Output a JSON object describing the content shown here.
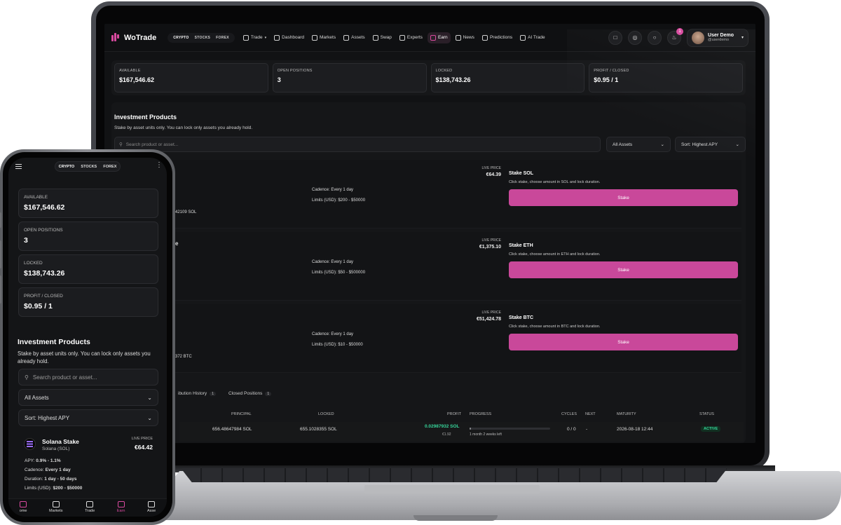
{
  "brand": {
    "name": "WoTrade",
    "accent": "#d94a9f",
    "button_color": "#c9489a"
  },
  "nav": {
    "segments": [
      "CRYPTO",
      "STOCKS",
      "FOREX"
    ],
    "items": [
      {
        "label": "Trade",
        "icon": "trade-icon"
      },
      {
        "label": "Dashboard",
        "icon": "home-icon"
      },
      {
        "label": "Markets",
        "icon": "chart-icon"
      },
      {
        "label": "Assets",
        "icon": "briefcase-icon"
      },
      {
        "label": "Swap",
        "icon": "swap-icon"
      },
      {
        "label": "Experts",
        "icon": "experts-icon"
      },
      {
        "label": "Earn",
        "icon": "wallet-icon"
      },
      {
        "label": "News",
        "icon": "news-icon"
      },
      {
        "label": "Predictions",
        "icon": "predictions-icon"
      },
      {
        "label": "AI Trade",
        "icon": "robot-icon"
      }
    ],
    "notification_count": "1",
    "user": {
      "name": "User Demo",
      "handle": "@userdemo"
    }
  },
  "stats": [
    {
      "label": "AVAILABLE",
      "value": "$167,546.62"
    },
    {
      "label": "OPEN POSITIONS",
      "value": "3"
    },
    {
      "label": "LOCKED",
      "value": "$138,743.26"
    },
    {
      "label": "PROFIT / CLOSED",
      "value": "$0.95 / 1"
    }
  ],
  "invest": {
    "title": "Investment Products",
    "subtitle": "Stake by asset units only. You can lock only assets you already hold.",
    "search_placeholder": "Search product or asset...",
    "filter": "All Assets",
    "sort": "Sort: Highest APY",
    "live_price_label": "LIVE PRICE",
    "lock_hint_prefix": "Click stake, choose amount in",
    "stake_label": "Stake"
  },
  "products": [
    {
      "stake_title": "Stake SOL",
      "live_price": "€64.39",
      "cadence": "Cadence: Every 1 day",
      "limits": "Limits (USD): $200 - $50000",
      "fragment": "42109 SOL",
      "hint": "Click stake, choose amount in SOL and lock duration."
    },
    {
      "stake_title": "Stake ETH",
      "live_price": "€1,375.10",
      "cadence": "Cadence: Every 1 day",
      "limits": "Limits (USD): $50 - $500000",
      "fragment": "e",
      "hint": "Click stake, choose amount in ETH and lock duration."
    },
    {
      "stake_title": "Stake BTC",
      "live_price": "€51,424.78",
      "cadence": "Cadence: Every 1 day",
      "limits": "Limits (USD): $10 - $50000",
      "fragment": "372 BTC",
      "hint": "Click stake, choose amount in BTC and lock duration."
    }
  ],
  "tabs": [
    {
      "label": "ibution History",
      "count": "1"
    },
    {
      "label": "Closed Positions",
      "count": "1"
    }
  ],
  "table": {
    "headers": [
      "PRINCIPAL",
      "LOCKED",
      "PROFIT",
      "PROGRESS",
      "CYCLES",
      "NEXT",
      "MATURITY",
      "STATUS"
    ],
    "row": {
      "principal": "656.48647984 SOL",
      "locked": "655.1028355 SOL",
      "profit": "0.02987932 SOL",
      "profit_fiat": "€1.92",
      "progress_text": "1 month 2 weeks left",
      "progress": 0.02,
      "cycles": "0 / 0",
      "next": "-",
      "maturity": "2026-08-18 12:44",
      "status": "ACTIVE"
    }
  },
  "mobile": {
    "segments": [
      "CRYPTO",
      "STOCKS",
      "FOREX"
    ],
    "subtitle_line1": "Stake by asset units only. You can lock only assets you",
    "subtitle_line2": "already hold.",
    "product": {
      "name": "Solana Stake",
      "asset": "Solana (SOL)",
      "live_price": "€64.42",
      "apy_label": "APY:",
      "apy": "0.9% - 1.1%",
      "cadence_label": "Cadence:",
      "cadence": "Every 1 day",
      "duration_label": "Duration:",
      "duration": "1 day - 50 days",
      "limits_label": "Limits (USD):",
      "limits": "$200 - $50000"
    },
    "bottom_nav": [
      {
        "label": "ome"
      },
      {
        "label": "Markets"
      },
      {
        "label": "Trade"
      },
      {
        "label": "Earn"
      },
      {
        "label": "Asse"
      }
    ]
  }
}
